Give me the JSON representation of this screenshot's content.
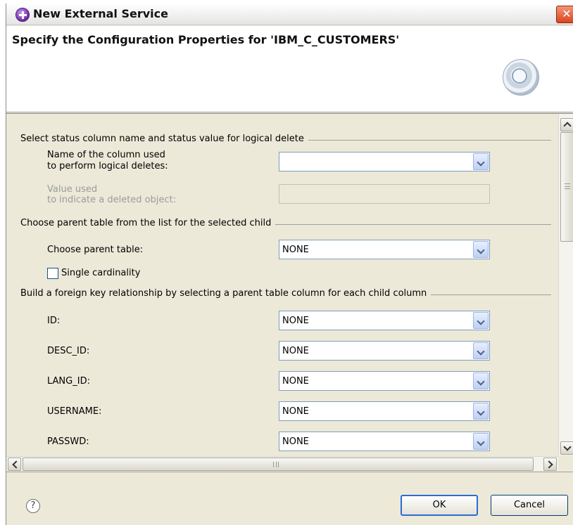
{
  "window": {
    "title": "New External Service"
  },
  "header": {
    "title": "Specify the Configuration Properties for 'IBM_C_CUSTOMERS'"
  },
  "icons": {
    "title": "service-wizard-icon",
    "close": "close-icon",
    "wizard": "wizard-banner-icon",
    "help": "help-icon"
  },
  "sections": {
    "logical_delete": {
      "title": "Select status column name and status value for logical delete",
      "column_label_line1": "Name of the column used",
      "column_label_line2": "to perform logical deletes:",
      "column_value": "",
      "value_label_line1": "Value used",
      "value_label_line2": "to indicate a deleted object:"
    },
    "parent_table": {
      "title": "Choose parent table from the list for the selected child",
      "choose_label": "Choose parent table:",
      "choose_value": "NONE",
      "single_cardinality_label": "Single cardinality",
      "single_cardinality_checked": false
    },
    "foreign_key": {
      "title": "Build a foreign key relationship by selecting a parent table column for each child column",
      "rows": [
        {
          "label": "ID:",
          "value": "NONE"
        },
        {
          "label": "DESC_ID:",
          "value": "NONE"
        },
        {
          "label": "LANG_ID:",
          "value": "NONE"
        },
        {
          "label": "USERNAME:",
          "value": "NONE"
        },
        {
          "label": "PASSWD:",
          "value": "NONE"
        }
      ]
    }
  },
  "footer": {
    "help_symbol": "?",
    "ok_label": "OK",
    "cancel_label": "Cancel"
  }
}
